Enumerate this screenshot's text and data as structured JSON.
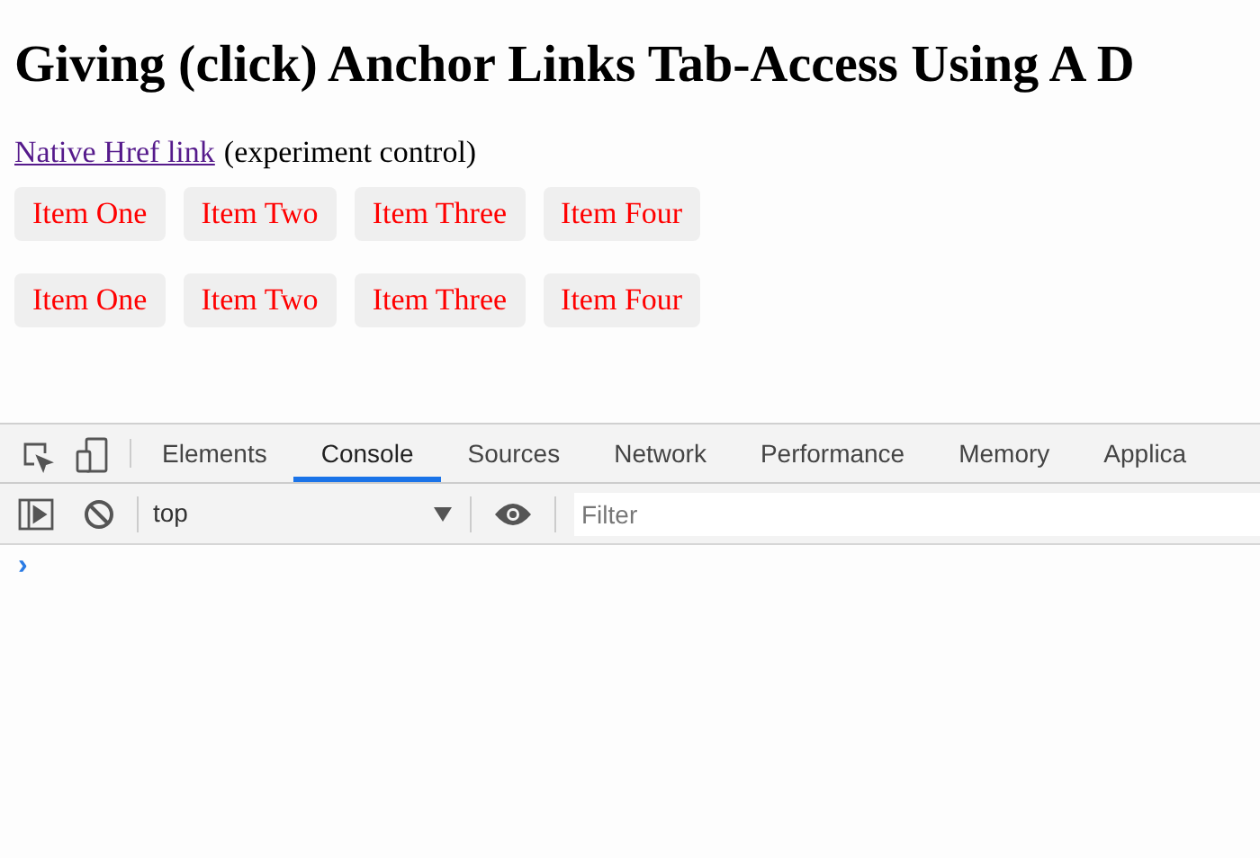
{
  "page": {
    "heading": "Giving (click) Anchor Links Tab-Access Using A D",
    "link": "Native Href link",
    "link_note": "(experiment control)",
    "button_rows": [
      [
        "Item One",
        "Item Two",
        "Item Three",
        "Item Four"
      ],
      [
        "Item One",
        "Item Two",
        "Item Three",
        "Item Four"
      ]
    ]
  },
  "devtools": {
    "tabs": [
      {
        "label": "Elements",
        "selected": false
      },
      {
        "label": "Console",
        "selected": true
      },
      {
        "label": "Sources",
        "selected": false
      },
      {
        "label": "Network",
        "selected": false
      },
      {
        "label": "Performance",
        "selected": false
      },
      {
        "label": "Memory",
        "selected": false
      },
      {
        "label": "Applica",
        "selected": false
      }
    ],
    "context": "top",
    "filter": {
      "placeholder": "Filter"
    },
    "prompt": "›"
  }
}
